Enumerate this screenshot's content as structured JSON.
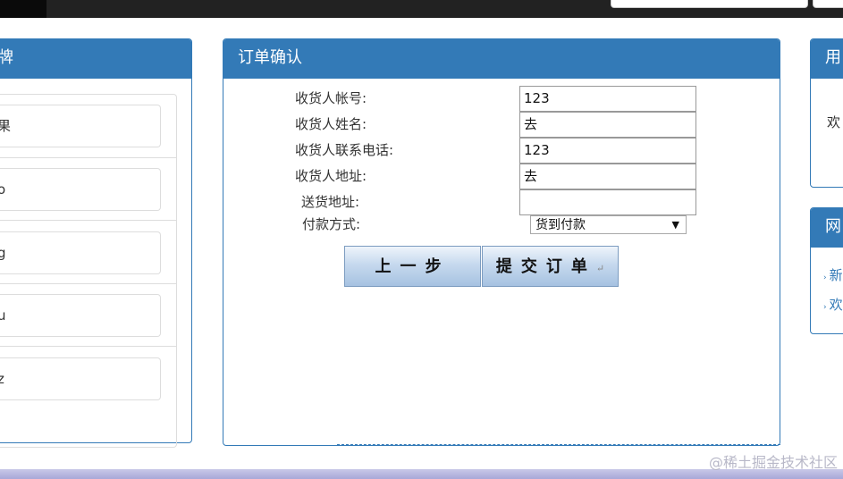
{
  "colors": {
    "primary": "#337ab7",
    "topbar": "#222222"
  },
  "left_panel": {
    "title": "牌",
    "brands": [
      {
        "label": "果"
      },
      {
        "label": "o"
      },
      {
        "label": "g"
      },
      {
        "label": "u"
      },
      {
        "label": "z"
      }
    ]
  },
  "order_panel": {
    "title": "订单确认",
    "fields": [
      {
        "label": "收货人帐号:",
        "value": "123"
      },
      {
        "label": "收货人姓名:",
        "value": "去"
      },
      {
        "label": "收货人联系电话:",
        "value": "123"
      },
      {
        "label": "收货人地址:",
        "value": "去"
      },
      {
        "label": "送货地址:",
        "value": ""
      }
    ],
    "payment": {
      "label": "付款方式:",
      "selected": "货到付款"
    },
    "buttons": {
      "prev": "上一步",
      "submit": "提交订单",
      "submit_mark": "↵"
    }
  },
  "user_panel": {
    "title": "用",
    "welcome": "欢"
  },
  "site_panel": {
    "title": "网",
    "links": [
      {
        "label": "新"
      },
      {
        "label": "欢"
      }
    ]
  },
  "watermark": "@稀土掘金技术社区"
}
